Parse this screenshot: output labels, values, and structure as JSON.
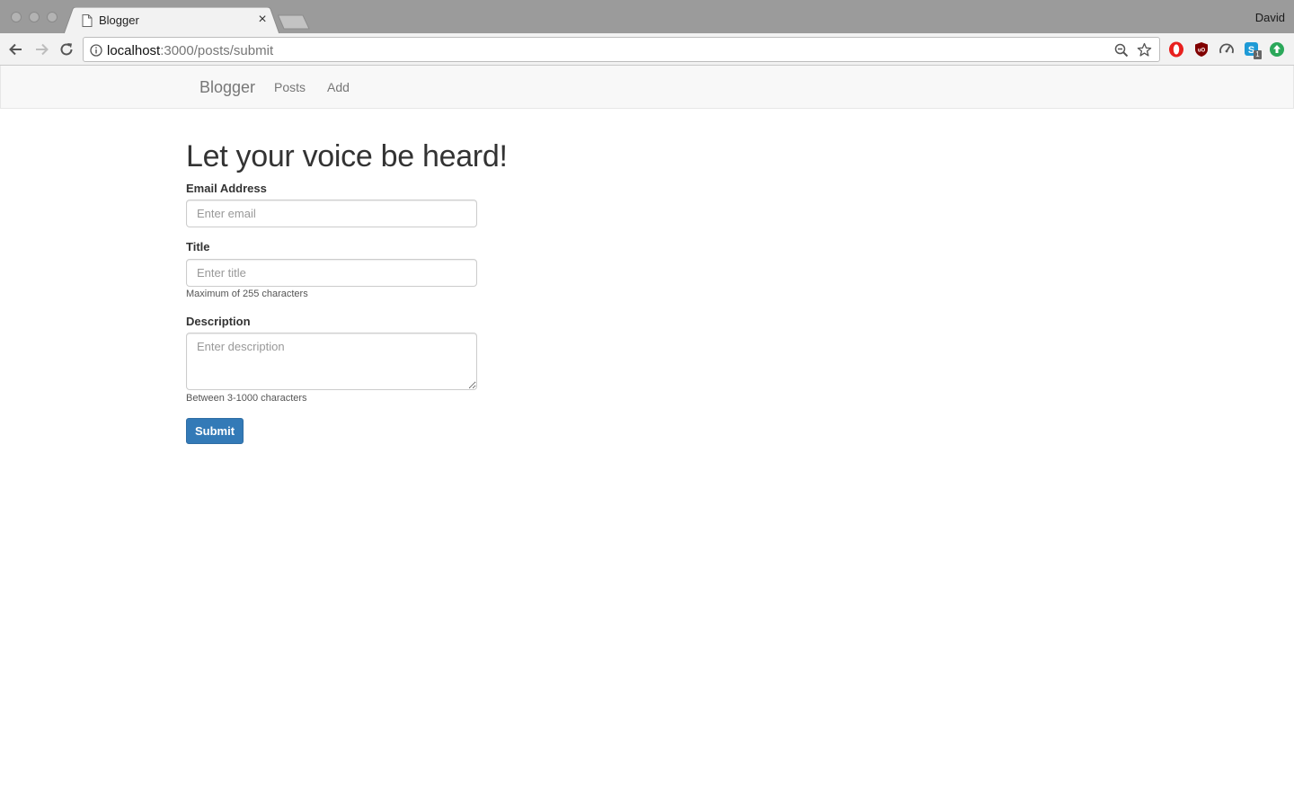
{
  "browser": {
    "tab_title": "Blogger",
    "profile_name": "David",
    "url_host": "localhost",
    "url_path": ":3000/posts/submit"
  },
  "navbar": {
    "brand": "Blogger",
    "links": [
      "Posts",
      "Add"
    ]
  },
  "form": {
    "heading": "Let your voice be heard!",
    "email": {
      "label": "Email Address",
      "placeholder": "Enter email",
      "value": ""
    },
    "title": {
      "label": "Title",
      "placeholder": "Enter title",
      "value": "",
      "help": "Maximum of 255 characters"
    },
    "description": {
      "label": "Description",
      "placeholder": "Enter description",
      "value": "",
      "help": "Between 3-1000 characters"
    },
    "submit_label": "Submit"
  },
  "icons": {
    "extensions": [
      "opera-icon",
      "ublock-icon",
      "speedometer-icon",
      "skype-icon",
      "green-upload-icon"
    ],
    "skype_badge": "1"
  },
  "colors": {
    "primary": "#337ab7",
    "navbar_bg": "#f8f8f8",
    "titlebar_bg": "#9b9b9b"
  }
}
